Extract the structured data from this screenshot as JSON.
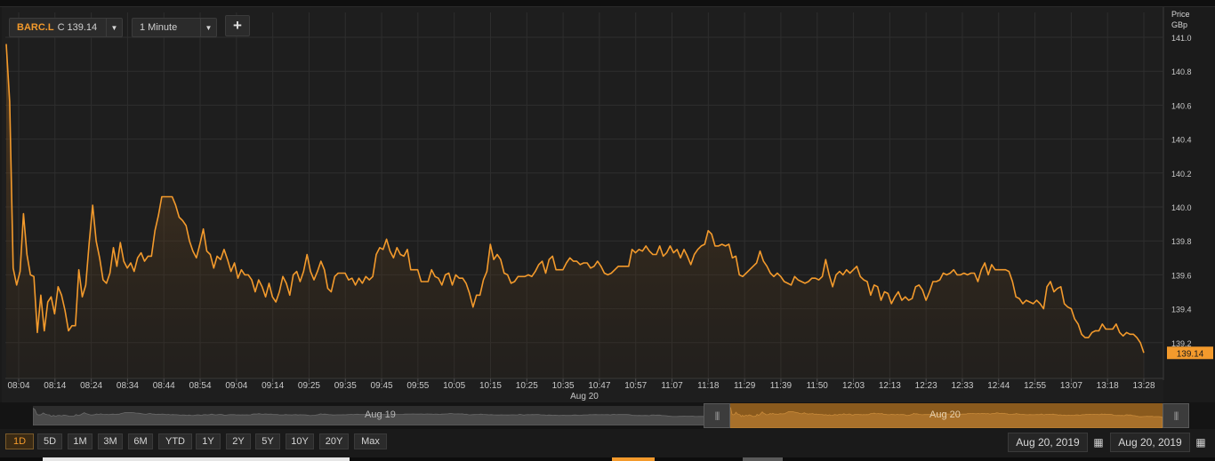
{
  "toolbar": {
    "symbol": "BARC.L",
    "last_label": "C",
    "last_value": "139.14",
    "interval": "1 Minute",
    "add_label": "+"
  },
  "colors": {
    "line": "#f39a2c",
    "background": "#1e1e1e",
    "grid": "#2e2e2e"
  },
  "chart_data": {
    "type": "area",
    "yaxis_title_1": "Price",
    "yaxis_title_2": "GBp",
    "ylim": [
      139.0,
      141.0
    ],
    "y_ticks": [
      "141.0",
      "140.8",
      "140.6",
      "140.4",
      "140.2",
      "140.0",
      "139.8",
      "139.6",
      "139.4",
      "139.2"
    ],
    "x_ticks": [
      "08:04",
      "08:14",
      "08:24",
      "08:34",
      "08:44",
      "08:54",
      "09:04",
      "09:14",
      "09:25",
      "09:35",
      "09:45",
      "09:55",
      "10:05",
      "10:15",
      "10:25",
      "10:35",
      "10:47",
      "10:57",
      "11:07",
      "11:18",
      "11:29",
      "11:39",
      "11:50",
      "12:03",
      "12:13",
      "12:23",
      "12:33",
      "12:44",
      "12:55",
      "13:07",
      "13:18",
      "13:28"
    ],
    "date_label": "Aug 20",
    "last_price_label": "139.14",
    "grid": true,
    "series": [
      {
        "values": [
          140.96,
          140.62,
          139.64,
          139.54,
          139.62,
          139.96,
          139.72,
          139.6,
          139.59,
          139.26,
          139.48,
          139.27,
          139.44,
          139.47,
          139.37,
          139.53,
          139.48,
          139.39,
          139.27,
          139.3,
          139.3,
          139.63,
          139.47,
          139.54,
          139.79,
          140.01,
          139.8,
          139.7,
          139.57,
          139.55,
          139.61,
          139.76,
          139.65,
          139.79,
          139.68,
          139.64,
          139.67,
          139.62,
          139.7,
          139.73,
          139.68,
          139.71,
          139.71,
          139.86,
          139.95,
          140.06,
          140.06,
          140.06,
          140.06,
          140.01,
          139.94,
          139.92,
          139.89,
          139.8,
          139.74,
          139.7,
          139.78,
          139.87,
          139.74,
          139.72,
          139.64,
          139.71,
          139.69,
          139.75,
          139.69,
          139.62,
          139.67,
          139.58,
          139.63,
          139.6,
          139.6,
          139.57,
          139.5,
          139.57,
          139.53,
          139.47,
          139.55,
          139.47,
          139.44,
          139.5,
          139.59,
          139.55,
          139.48,
          139.6,
          139.62,
          139.56,
          139.62,
          139.72,
          139.62,
          139.57,
          139.62,
          139.68,
          139.63,
          139.52,
          139.5,
          139.59,
          139.61,
          139.61,
          139.61,
          139.57,
          139.58,
          139.54,
          139.58,
          139.55,
          139.59,
          139.57,
          139.59,
          139.72,
          139.76,
          139.75,
          139.81,
          139.74,
          139.7,
          139.76,
          139.72,
          139.71,
          139.75,
          139.63,
          139.63,
          139.63,
          139.56,
          139.56,
          139.56,
          139.63,
          139.59,
          139.58,
          139.54,
          139.6,
          139.61,
          139.54,
          139.6,
          139.58,
          139.58,
          139.55,
          139.49,
          139.41,
          139.48,
          139.48,
          139.57,
          139.62,
          139.78,
          139.69,
          139.72,
          139.69,
          139.61,
          139.6,
          139.55,
          139.56,
          139.59,
          139.59,
          139.59,
          139.6,
          139.59,
          139.62,
          139.66,
          139.68,
          139.61,
          139.69,
          139.71,
          139.63,
          139.63,
          139.63,
          139.67,
          139.7,
          139.68,
          139.68,
          139.66,
          139.67,
          139.67,
          139.64,
          139.65,
          139.68,
          139.65,
          139.61,
          139.6,
          139.61,
          139.63,
          139.65,
          139.65,
          139.65,
          139.65,
          139.75,
          139.73,
          139.75,
          139.74,
          139.77,
          139.74,
          139.72,
          139.72,
          139.77,
          139.71,
          139.73,
          139.77,
          139.73,
          139.75,
          139.7,
          139.75,
          139.71,
          139.66,
          139.72,
          139.75,
          139.77,
          139.78,
          139.86,
          139.84,
          139.77,
          139.77,
          139.78,
          139.77,
          139.78,
          139.7,
          139.71,
          139.6,
          139.59,
          139.61,
          139.63,
          139.65,
          139.67,
          139.74,
          139.68,
          139.65,
          139.61,
          139.59,
          139.61,
          139.59,
          139.56,
          139.55,
          139.54,
          139.59,
          139.57,
          139.56,
          139.55,
          139.56,
          139.58,
          139.58,
          139.57,
          139.59,
          139.69,
          139.6,
          139.53,
          139.6,
          139.62,
          139.6,
          139.63,
          139.61,
          139.63,
          139.65,
          139.59,
          139.57,
          139.56,
          139.48,
          139.54,
          139.53,
          139.45,
          139.5,
          139.49,
          139.43,
          139.47,
          139.5,
          139.45,
          139.47,
          139.45,
          139.46,
          139.53,
          139.54,
          139.51,
          139.45,
          139.5,
          139.56,
          139.56,
          139.57,
          139.61,
          139.6,
          139.61,
          139.63,
          139.6,
          139.6,
          139.61,
          139.6,
          139.61,
          139.61,
          139.56,
          139.63,
          139.67,
          139.6,
          139.66,
          139.63,
          139.63,
          139.63,
          139.63,
          139.62,
          139.56,
          139.47,
          139.46,
          139.43,
          139.45,
          139.44,
          139.43,
          139.45,
          139.43,
          139.4,
          139.53,
          139.56,
          139.5,
          139.52,
          139.53,
          139.43,
          139.41,
          139.4,
          139.34,
          139.31,
          139.25,
          139.23,
          139.23,
          139.26,
          139.27,
          139.27,
          139.31,
          139.28,
          139.28,
          139.28,
          139.31,
          139.26,
          139.24,
          139.26,
          139.25,
          139.25,
          139.23,
          139.2,
          139.14
        ]
      }
    ]
  },
  "navigator": {
    "left_label": "Aug 19",
    "right_label": "Aug 20"
  },
  "range_buttons": [
    "1D",
    "5D",
    "1M",
    "3M",
    "6M",
    "YTD",
    "1Y",
    "2Y",
    "5Y",
    "10Y",
    "20Y",
    "Max"
  ],
  "date_range": {
    "from": "Aug 20, 2019",
    "to": "Aug 20, 2019"
  }
}
